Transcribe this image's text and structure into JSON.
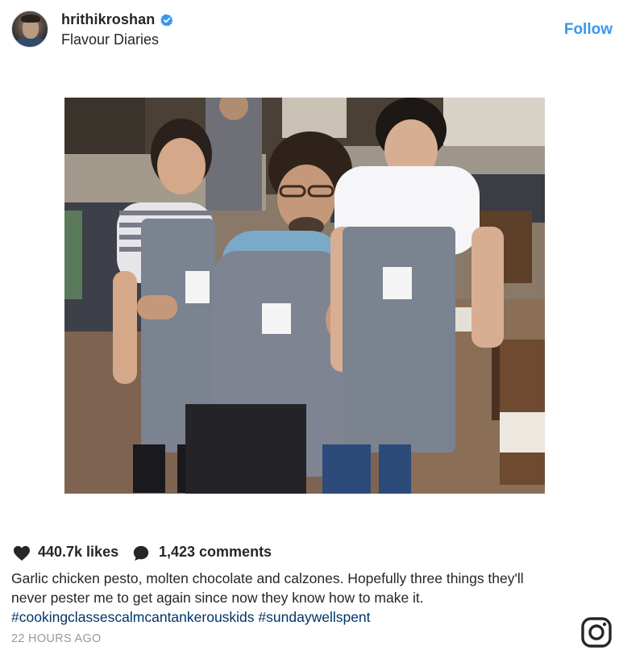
{
  "header": {
    "username": "hrithikroshan",
    "location": "Flavour Diaries",
    "follow_label": "Follow",
    "verified_icon": "verified-badge-icon",
    "verified_color": "#3897f0"
  },
  "photo": {
    "alt": "Hrithik Roshan posing with two boys wearing grey aprons in a restaurant kitchen"
  },
  "stats": {
    "likes": "440.7k likes",
    "comments": "1,423 comments",
    "heart_icon": "heart-icon",
    "comment_icon": "comment-bubble-icon"
  },
  "caption": {
    "text": "Garlic chicken pesto, molten chocolate and calzones. Hopefully three things they'll never pester me to get again since now they know how to make it.",
    "hashtags": "#cookingclassescalmcantankerouskids #sundaywellspent"
  },
  "meta": {
    "timestamp": "22 HOURS AGO",
    "brand_icon": "instagram-icon"
  },
  "colors": {
    "link_blue": "#3897f0",
    "hashtag_blue": "#003569",
    "muted_gray": "#999999",
    "text": "#262626"
  }
}
